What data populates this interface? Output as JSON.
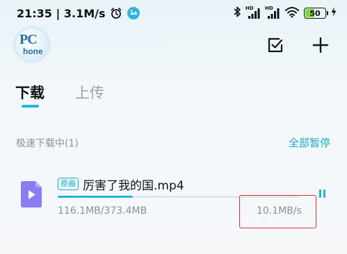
{
  "status_bar": {
    "time_speed": "21:35 | 3.1M/s",
    "hd_label_1": "HD",
    "hd_label_2": "HD",
    "battery_level": "50"
  },
  "header": {
    "logo_top": "PC",
    "logo_bottom": "hone"
  },
  "tabs": [
    {
      "label": "下载",
      "active": true
    },
    {
      "label": "上传",
      "active": false
    }
  ],
  "section": {
    "title": "极速下载中(1)",
    "action_label": "全部暂停"
  },
  "downloads": [
    {
      "tag": "原画",
      "name": "厉害了我的国.mp4",
      "size": "116.1MB/373.4MB",
      "speed": "10.1MB/s",
      "progress": 0.311
    }
  ],
  "colors": {
    "accent": "#1fb8d8",
    "highlight_box": "#e0303a",
    "battery_fill": "#78d93a",
    "file_icon": "#8a7cf3"
  }
}
